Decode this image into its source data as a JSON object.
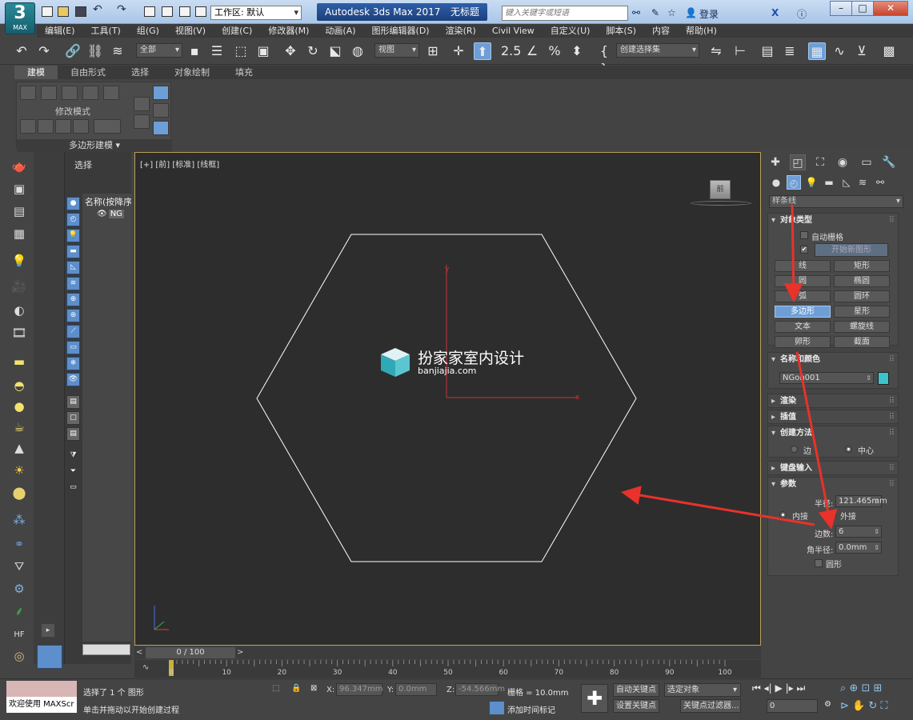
{
  "titlebar": {
    "logo_main": "3",
    "logo_sub": "MAX",
    "workspace": "工作区: 默认",
    "app_title": "Autodesk 3ds Max 2017",
    "doc_title": "无标题",
    "search_placeholder": "键入关键字或短语",
    "login": "登录"
  },
  "menubar": {
    "items": [
      "编辑(E)",
      "工具(T)",
      "组(G)",
      "视图(V)",
      "创建(C)",
      "修改器(M)",
      "动画(A)",
      "图形编辑器(D)",
      "渲染(R)",
      "Civil View",
      "自定义(U)",
      "脚本(S)",
      "内容",
      "帮助(H)"
    ]
  },
  "toolbar": {
    "filter": "全部",
    "refcoord": "视图",
    "selection_set": "创建选择集"
  },
  "ribbon": {
    "tabs": [
      "建模",
      "自由形式",
      "选择",
      "对象绘制",
      "填充"
    ],
    "modify_mode": "修改模式",
    "poly_modeling": "多边形建模"
  },
  "explorer": {
    "select_label": "选择",
    "column_header": "名称(按降序",
    "row_chip": "NG"
  },
  "viewport": {
    "label": "[+] [前] [标准] [线框]",
    "watermark_title": "扮家家室内设计",
    "watermark_sub": "banjiajia.com",
    "axis_y": "y",
    "axis_x": "x",
    "cube_label": "前"
  },
  "timeline": {
    "frame": "0 / 100",
    "ticks": [
      "0",
      "10",
      "20",
      "30",
      "40",
      "50",
      "60",
      "70",
      "80",
      "90",
      "100"
    ]
  },
  "status": {
    "maxscript": "欢迎使用 MAXScr",
    "selected": "选择了 1 个 图形",
    "prompt": "单击并拖动以开始创建过程",
    "x_label": "X:",
    "x_value": "96.347mm",
    "y_label": "Y:",
    "y_value": "0.0mm",
    "z_label": "Z:",
    "z_value": "-54.566mm",
    "grid": "栅格 = 10.0mm",
    "add_time_tag": "添加时间标记",
    "auto_key": "自动关键点",
    "set_key": "设置关键点",
    "selected_obj": "选定对象",
    "key_filters": "关键点过滤器...",
    "frame_field": "0"
  },
  "cmdpanel": {
    "category": "样条线",
    "object_type": {
      "title": "对象类型",
      "auto_grid": "自动栅格",
      "start_new_shape": "开始新图形",
      "buttons": [
        "线",
        "矩形",
        "圆",
        "椭圆",
        "弧",
        "圆环",
        "多边形",
        "星形",
        "文本",
        "螺旋线",
        "卵形",
        "截面"
      ]
    },
    "name_color": {
      "title": "名称和颜色",
      "name": "NGon001",
      "color": "#3bc4cc"
    },
    "render": "渲染",
    "interp": "插值",
    "creation_method": {
      "title": "创建方法",
      "edge": "边",
      "center": "中心"
    },
    "keyboard_entry": "键盘输入",
    "params": {
      "title": "参数",
      "radius_label": "半径:",
      "radius": "121.465mm",
      "inscribed": "内接",
      "circumscribed": "外接",
      "sides_label": "边数:",
      "sides": "6",
      "corner_label": "角半径:",
      "corner": "0.0mm",
      "circular": "圆形"
    }
  },
  "colors": {
    "accent": "#6d9ed6",
    "annotation": "#e8322a",
    "viewport_border": "#b8a15a"
  }
}
